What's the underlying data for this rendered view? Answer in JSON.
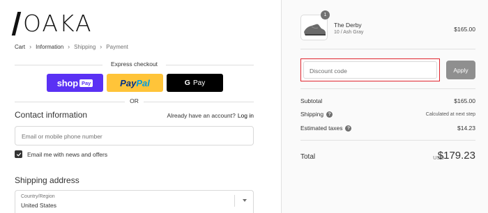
{
  "brand": {
    "name": "OAKA"
  },
  "breadcrumb": {
    "items": [
      {
        "label": "Cart",
        "active": true
      },
      {
        "label": "Information",
        "active": true
      },
      {
        "label": "Shipping",
        "active": false
      },
      {
        "label": "Payment",
        "active": false
      }
    ],
    "separator_icon": "chevron-right-icon"
  },
  "express_checkout": {
    "label": "Express checkout",
    "buttons": [
      {
        "id": "shop_pay",
        "word": "shop",
        "badge": "Pay",
        "color": "#5a31f4"
      },
      {
        "id": "paypal",
        "part1": "Pay",
        "part2": "Pal",
        "color": "#ffc439"
      },
      {
        "id": "google_pay",
        "g": "G",
        "label": "Pay",
        "color": "#000000"
      }
    ],
    "or_label": "OR"
  },
  "contact": {
    "heading": "Contact information",
    "account_prompt": "Already have an account?",
    "login_label": "Log in",
    "email_placeholder": "Email or mobile phone number",
    "newsletter_label": "Email me with news and offers",
    "newsletter_checked": true
  },
  "shipping": {
    "heading": "Shipping address",
    "country_label": "Country/Region",
    "country_value": "United States"
  },
  "cart": {
    "quantity": "1",
    "product_name": "The Derby",
    "product_variant": "10 / Ash Gray",
    "product_price": "$165.00"
  },
  "discount": {
    "placeholder": "Discount code",
    "apply_label": "Apply",
    "highlight_color": "#e0232c"
  },
  "summary": {
    "subtotal_label": "Subtotal",
    "subtotal_value": "$165.00",
    "shipping_label": "Shipping",
    "shipping_value": "Calculated at next step",
    "taxes_label": "Estimated taxes",
    "taxes_value": "$14.23",
    "total_label": "Total",
    "total_currency": "USD",
    "total_value": "$179.23"
  }
}
